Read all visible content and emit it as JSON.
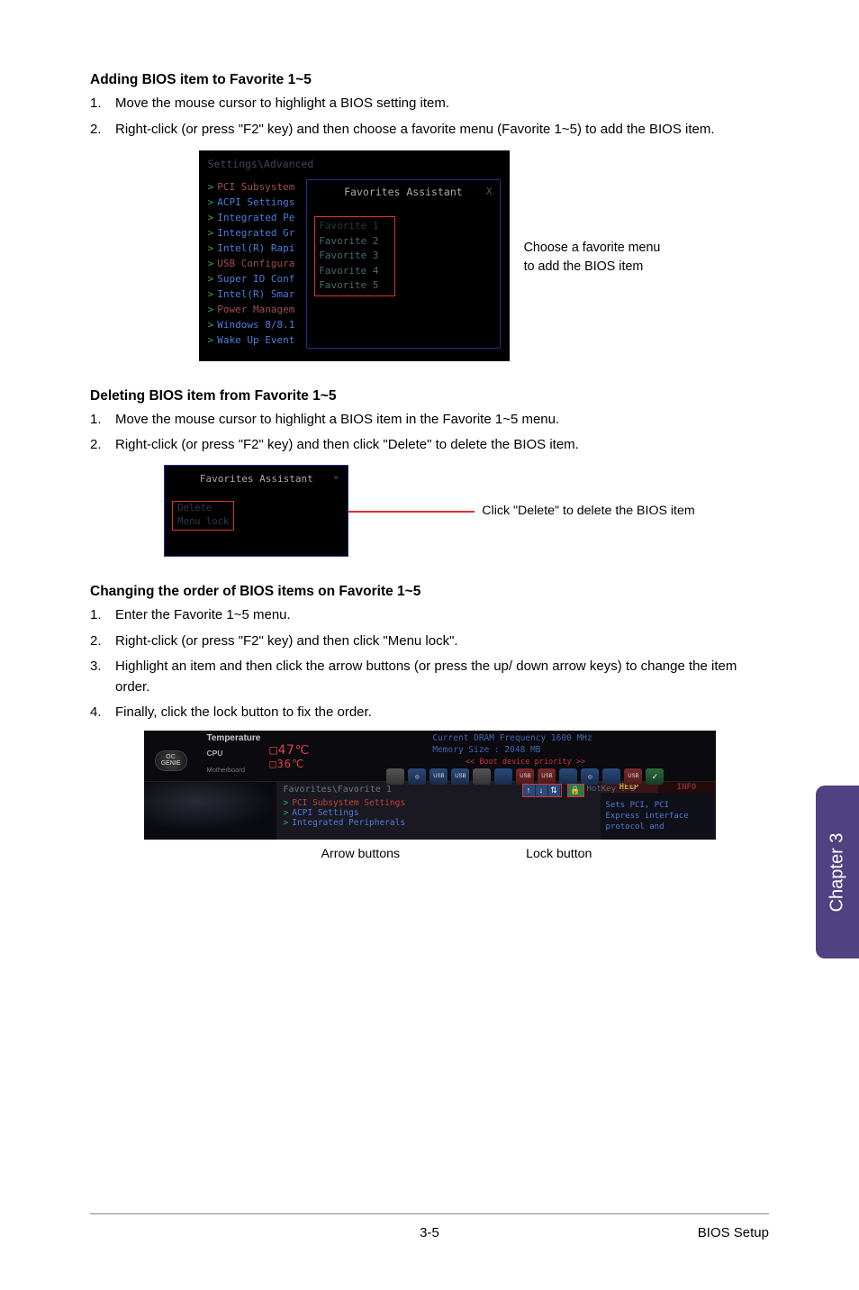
{
  "sections": {
    "adding": {
      "heading": "Adding BIOS item to Favorite 1~5",
      "steps": [
        "Move the mouse cursor to highlight a BIOS setting item.",
        "Right-click (or press \"F2\" key) and then choose a favorite menu (Favorite 1~5) to add the BIOS item."
      ]
    },
    "deleting": {
      "heading": "Deleting BIOS item from Favorite 1~5",
      "steps": [
        "Move the mouse cursor to highlight a BIOS item in the Favorite 1~5 menu.",
        "Right-click (or press \"F2\" key) and then click \"Delete\" to delete the BIOS item."
      ]
    },
    "changing": {
      "heading": "Changing the order of BIOS items on Favorite 1~5",
      "steps": [
        "Enter the Favorite 1~5 menu.",
        "Right-click (or press \"F2\" key) and then click \"Menu lock\".",
        "Highlight an item and then click the arrow buttons (or press the up/ down arrow keys) to change the item order.",
        "Finally, click the lock button to fix the order."
      ]
    }
  },
  "shot1": {
    "breadcrumb": "Settings\\Advanced",
    "menu_items": [
      {
        "label": "PCI Subsystem",
        "red": true
      },
      {
        "label": "ACPI Settings",
        "red": false
      },
      {
        "label": "Integrated Pe",
        "red": false
      },
      {
        "label": "Integrated Gr",
        "red": false
      },
      {
        "label": "Intel(R) Rapi",
        "red": false
      },
      {
        "label": "USB Configura",
        "red": true
      },
      {
        "label": "Super IO Conf",
        "red": false
      },
      {
        "label": "Intel(R) Smar",
        "red": false
      },
      {
        "label": "Power Managem",
        "red": true
      },
      {
        "label": "Windows 8/8.1",
        "red": false
      },
      {
        "label": "Wake Up Event",
        "red": false
      }
    ],
    "popup_title": "Favorites Assistant",
    "close": "X",
    "favorites": [
      "Favorite 1",
      "Favorite 2",
      "Favorite 3",
      "Favorite 4",
      "Favorite 5"
    ],
    "callout_l1": "Choose a favorite menu",
    "callout_l2": "to add the BIOS item"
  },
  "shot2": {
    "popup_title": "Favorites Assistant",
    "close": "×",
    "options": [
      "Delete",
      "Menu lock"
    ],
    "callout": "Click \"Delete\" to delete the BIOS item"
  },
  "shot3": {
    "oc_l1": "OC",
    "oc_l2": "GENIE",
    "temp_heading": "Temperature",
    "cpu_label": "CPU",
    "mb_label": "Motherboard",
    "cpu_temp": "□47℃",
    "mb_temp": "□36℃",
    "dram_l1": "Current DRAM Frequency 1600 MHz",
    "dram_l2": "Memory Size : 2048 MB",
    "boot_label": "<<  Boot device priority  >>",
    "icons": [
      {
        "txt": "",
        "cls": "gry"
      },
      {
        "txt": "◎",
        "cls": ""
      },
      {
        "txt": "USB",
        "cls": ""
      },
      {
        "txt": "USB",
        "cls": ""
      },
      {
        "txt": "",
        "cls": "gry"
      },
      {
        "txt": "",
        "cls": ""
      },
      {
        "txt": "USB",
        "cls": "red"
      },
      {
        "txt": "USB",
        "cls": "red"
      },
      {
        "txt": "",
        "cls": ""
      },
      {
        "txt": "◎",
        "cls": ""
      },
      {
        "txt": "",
        "cls": ""
      },
      {
        "txt": "USB",
        "cls": "red"
      },
      {
        "txt": "✓",
        "cls": "grn"
      }
    ],
    "fav_path": "Favorites\\Favorite 1",
    "fav_items": [
      {
        "label": "PCI Subsystem Settings",
        "sel": true
      },
      {
        "label": "ACPI Settings",
        "sel": false
      },
      {
        "label": "Integrated Peripherals",
        "sel": false
      }
    ],
    "hotkey": "HotKey : 5",
    "help_active": "HELP",
    "help_inactive": "INFO",
    "help_txt_l1": "Sets PCI, PCI",
    "help_txt_l2": "Express interface",
    "help_txt_l3": "protocol and",
    "arrow_label": "Arrow buttons",
    "lock_label": "Lock button"
  },
  "side_tab": "Chapter 3",
  "footer": {
    "page": "3-5",
    "section": "BIOS Setup"
  }
}
